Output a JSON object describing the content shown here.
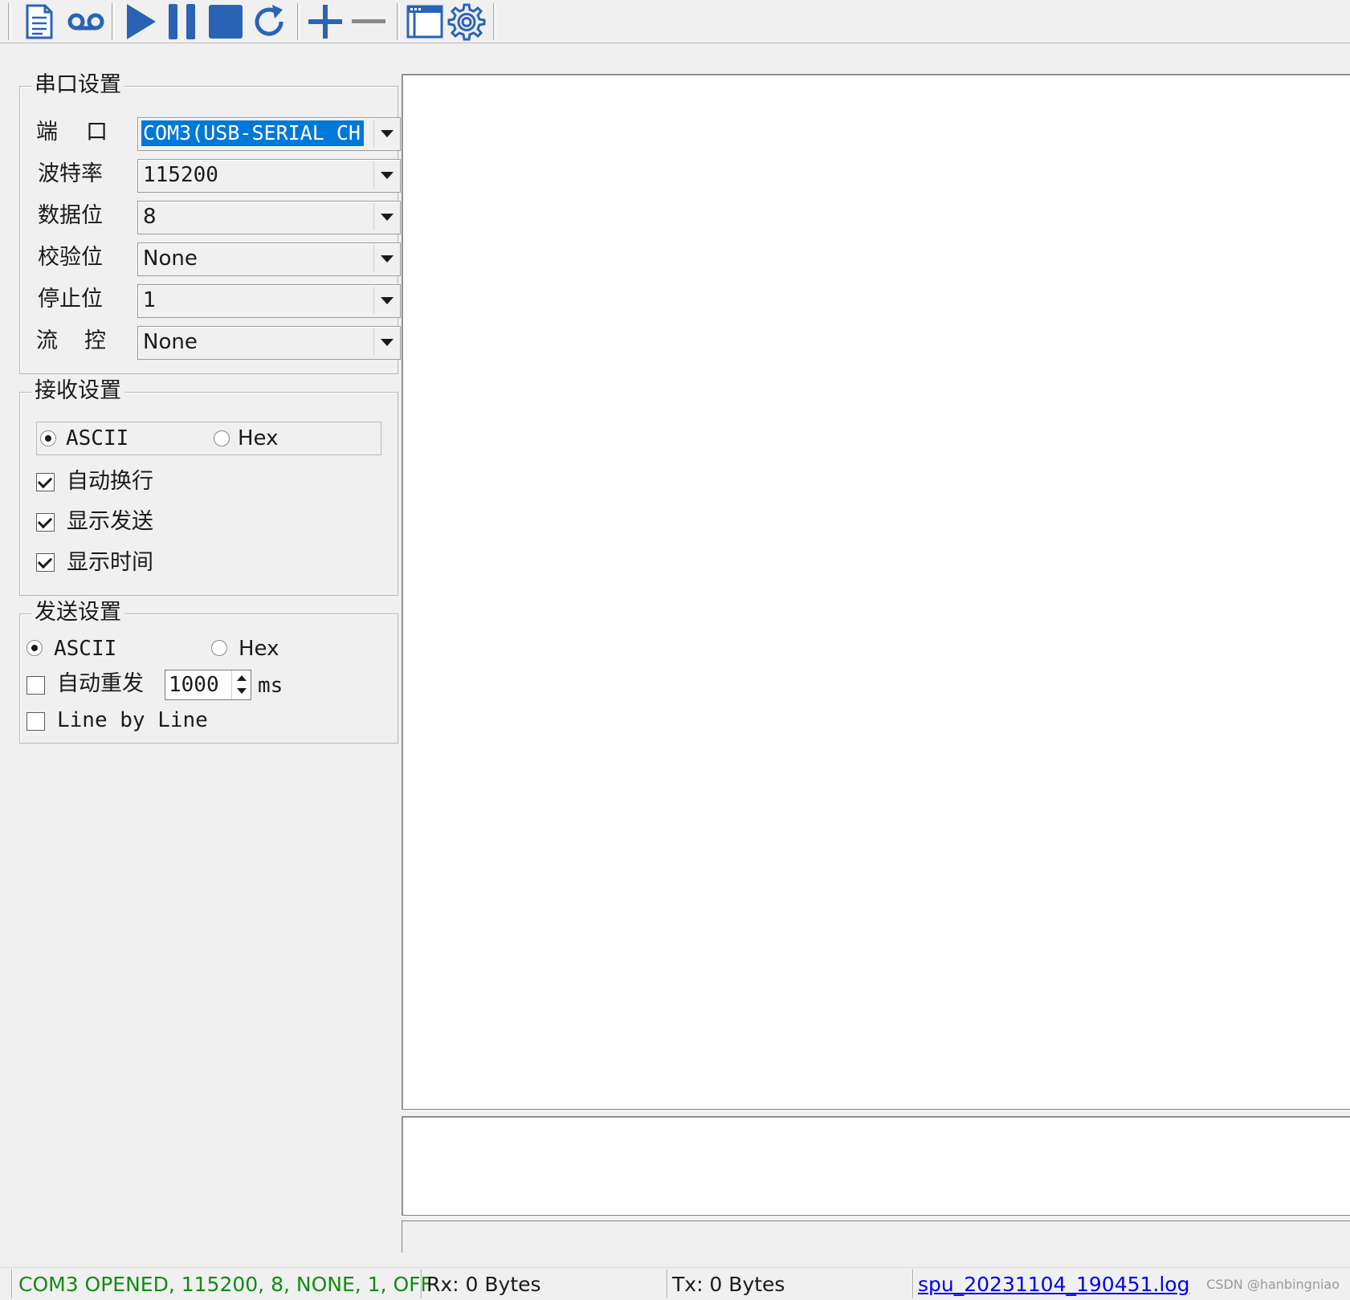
{
  "toolbar": {
    "icons": [
      "new-file-icon",
      "record-icon",
      "play-icon",
      "pause-icon",
      "stop-icon",
      "refresh-icon",
      "plus-icon",
      "minus-icon",
      "window-icon",
      "gear-icon"
    ],
    "accent": "#2b63b4"
  },
  "serial_settings": {
    "title": "串口设置",
    "port": {
      "label_a": "端",
      "label_b": "口",
      "value": "COM3(USB-SERIAL CH"
    },
    "baud": {
      "label": "波特率",
      "value": "115200"
    },
    "data": {
      "label": "数据位",
      "value": "8"
    },
    "parity": {
      "label": "校验位",
      "value": "None"
    },
    "stop": {
      "label": "停止位",
      "value": "1"
    },
    "flow": {
      "label_a": "流",
      "label_b": "控",
      "value": "None"
    }
  },
  "receive_settings": {
    "title": "接收设置",
    "mode_ascii": "ASCII",
    "mode_hex": "Hex",
    "selected_mode": "ASCII",
    "auto_wrap": {
      "label": "自动换行",
      "checked": true
    },
    "show_send": {
      "label": "显示发送",
      "checked": true
    },
    "show_time": {
      "label": "显示时间",
      "checked": true
    }
  },
  "send_settings": {
    "title": "发送设置",
    "mode_ascii": "ASCII",
    "mode_hex": "Hex",
    "selected_mode": "ASCII",
    "auto_resend": {
      "label": "自动重发",
      "checked": false,
      "interval": "1000",
      "unit": "ms"
    },
    "line_by_line": {
      "label": "Line by Line",
      "checked": false
    }
  },
  "status_bar": {
    "connection": "COM3 OPENED, 115200, 8, NONE, 1, OFF",
    "connection_color": "#138a13",
    "rx": "Rx: 0 Bytes",
    "tx": "Tx: 0 Bytes",
    "log_file": "spu_20231104_190451.log",
    "watermark": "CSDN @hanbingniao"
  }
}
